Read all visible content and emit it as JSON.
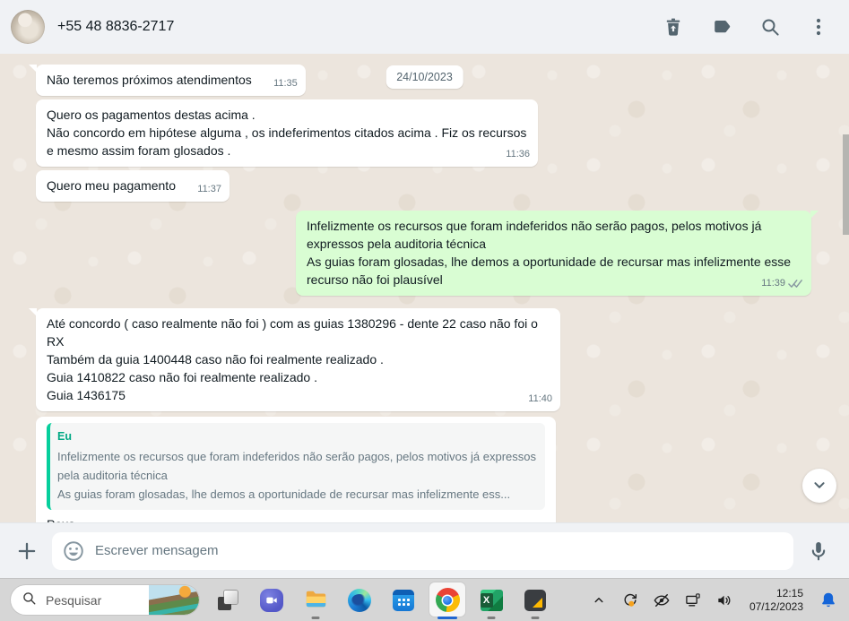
{
  "header": {
    "contact_name": "+55 48 8836-2717",
    "icons": [
      "delete-icon",
      "label-icon",
      "search-icon",
      "menu-icon"
    ]
  },
  "chat": {
    "date_pill": "24/10/2023",
    "messages": [
      {
        "direction": "in",
        "tail": true,
        "pad_time": true,
        "text": "Não teremos próximos atendimentos",
        "time": "11:35"
      },
      {
        "direction": "in",
        "tail": false,
        "text": "Quero os pagamentos destas acima .\nNão concordo em hipótese alguma , os indeferimentos citados acima . Fiz os recursos e mesmo assim foram glosados .",
        "time": "11:36"
      },
      {
        "direction": "in",
        "tail": false,
        "pad_time": true,
        "text": "Quero meu pagamento",
        "time": "11:37"
      },
      {
        "direction": "out",
        "tail": true,
        "ticks": "double",
        "text": "Infelizmente os recursos que foram indeferidos não serão pagos, pelos motivos já expressos pela auditoria técnica\nAs guias foram glosadas, lhe demos a oportunidade de recursar mas infelizmente esse recurso não foi plausível",
        "time": "11:39"
      },
      {
        "direction": "in",
        "tail": true,
        "text": "Até concordo ( caso realmente não foi ) com as guias 1380296 - dente 22 caso não foi o RX\nTambém da guia 1400448 caso não foi realmente realizado .\nGuia 1410822 caso não foi realmente realizado .\nGuia 1436175",
        "time": "11:40"
      },
      {
        "direction": "in",
        "tail": false,
        "quote": {
          "author": "Eu",
          "text": "Infelizmente os recursos que foram indeferidos não serão pagos, pelos motivos já expressos pela auditoria técnica\nAs guias foram glosadas, lhe demos a oportunidade de recursar mas infelizmente ess..."
        },
        "text": "Poxa\nIsso é fazer papel de bobo perante ao plano .",
        "time": null
      }
    ]
  },
  "composer": {
    "placeholder": "Escrever mensagem",
    "icons": [
      "plus-icon",
      "emoji-icon",
      "mic-icon"
    ]
  },
  "taskbar": {
    "search_placeholder": "Pesquisar",
    "apps": [
      {
        "name": "task-view",
        "running": false,
        "active": false
      },
      {
        "name": "chat",
        "running": false,
        "active": false
      },
      {
        "name": "file-explorer",
        "running": true,
        "active": false
      },
      {
        "name": "edge",
        "running": false,
        "active": false
      },
      {
        "name": "calendar",
        "running": false,
        "active": false
      },
      {
        "name": "chrome",
        "running": true,
        "active": true
      },
      {
        "name": "excel",
        "running": true,
        "active": false
      },
      {
        "name": "sticky-notes",
        "running": true,
        "active": false
      }
    ],
    "tray_icons": [
      "hidden-icons-chevron",
      "sync-icon",
      "eye-off-icon",
      "display-icon",
      "volume-icon"
    ],
    "clock": {
      "time": "12:15",
      "date": "07/12/2023"
    }
  },
  "colors": {
    "header_bg": "#f0f2f5",
    "chat_bg": "#ece5dd",
    "bubble_in": "#ffffff",
    "bubble_out": "#d9fdd3",
    "quote_accent": "#06cf9c",
    "quote_author": "#00a884",
    "time_text": "#667781",
    "icon_gray": "#54656f",
    "taskbar_bg": "#d6d6d6",
    "active_indicator": "#2166d1",
    "bell_blue": "#1565d8"
  },
  "excel_letter": "X"
}
